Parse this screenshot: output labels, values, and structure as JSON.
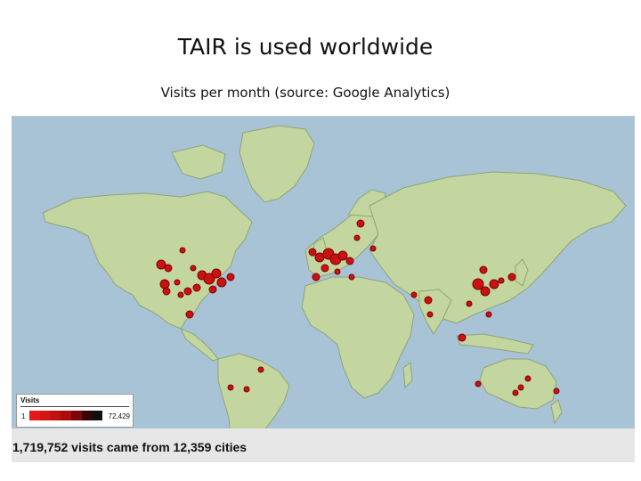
{
  "title": "TAIR is used worldwide",
  "subtitle": "Visits per month (source: Google Analytics)",
  "map": {
    "ocean_color": "#a8c3d6",
    "land_color": "#c3d6a0",
    "marker_color": "#cc1111"
  },
  "legend": {
    "title": "Visits",
    "min": "1",
    "max": "72,429",
    "scale_colors": [
      "#e41a1a",
      "#d11414",
      "#c20f0f",
      "#a80c0c",
      "#7a0808",
      "#3a0404",
      "#111111"
    ]
  },
  "footer": {
    "summary": "1,719,752 visits came from 12,359 cities"
  }
}
